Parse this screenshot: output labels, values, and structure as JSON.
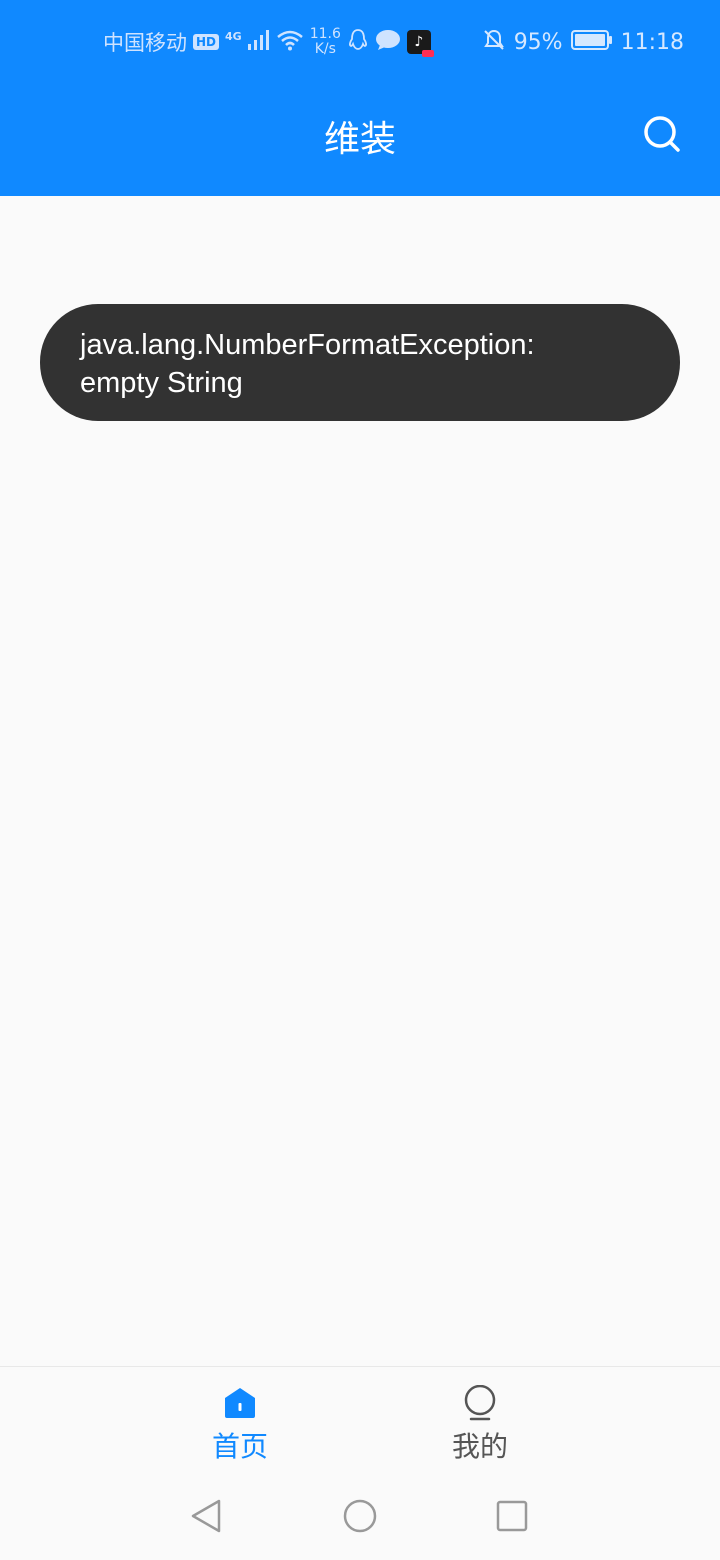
{
  "status_bar": {
    "carrier": "中国移动",
    "hd": "HD",
    "network_type": "4G",
    "speed_value": "11.6",
    "speed_unit": "K/s",
    "battery": "95%",
    "time": "11:18",
    "icons": [
      "signal-icon",
      "wifi-icon",
      "qq-icon",
      "message-icon",
      "tiktok-icon",
      "mute-bell-icon",
      "battery-icon"
    ]
  },
  "header": {
    "title": "维装",
    "search_icon": "search-icon"
  },
  "toast": {
    "line1": "java.lang.NumberFormatException:",
    "line2": "empty String"
  },
  "tabs": [
    {
      "label": "首页",
      "icon": "home-icon",
      "active": true
    },
    {
      "label": "我的",
      "icon": "profile-icon",
      "active": false
    }
  ],
  "nav_bar": {
    "icons": [
      "back-icon",
      "home-circle-icon",
      "recent-apps-icon"
    ]
  },
  "colors": {
    "primary": "#1089ff",
    "toast_bg": "#323232",
    "background": "#fafafa",
    "inactive_tab": "#555555"
  }
}
